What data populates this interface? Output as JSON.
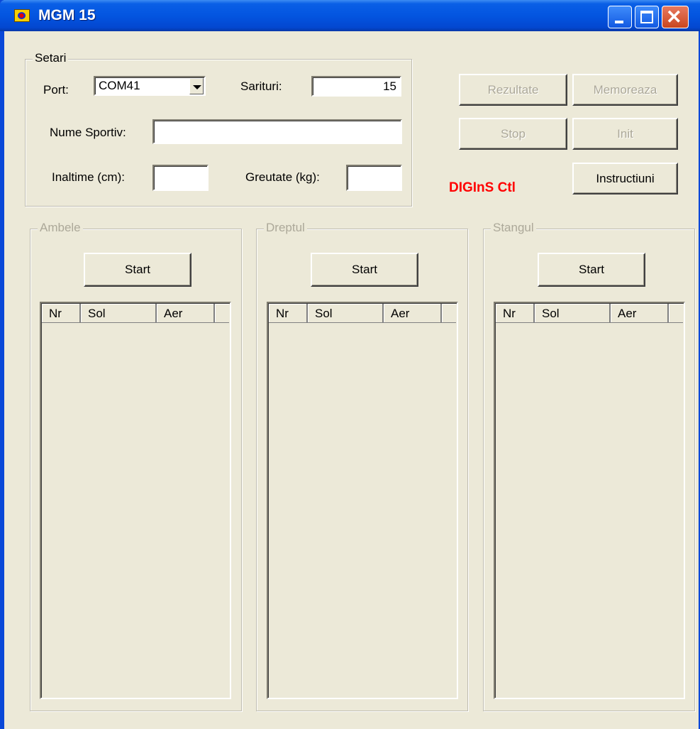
{
  "window": {
    "title": "MGM 15"
  },
  "settings": {
    "group_label": "Setari",
    "port_label": "Port:",
    "port_value": "COM41",
    "sarituri_label": "Sarituri:",
    "sarituri_value": "15",
    "nume_label": "Nume Sportiv:",
    "nume_value": "",
    "inaltime_label": "Inaltime (cm):",
    "inaltime_value": "",
    "greutate_label": "Greutate (kg):",
    "greutate_value": ""
  },
  "actions": {
    "rezultate": "Rezultate",
    "memoreaza": "Memoreaza",
    "stop": "Stop",
    "init": "Init",
    "instructiuni": "Instructiuni"
  },
  "brand": "DIGInS Ctl",
  "panels": [
    {
      "label": "Ambele",
      "start": "Start",
      "columns": [
        "Nr",
        "Sol",
        "Aer"
      ]
    },
    {
      "label": "Dreptul",
      "start": "Start",
      "columns": [
        "Nr",
        "Sol",
        "Aer"
      ]
    },
    {
      "label": "Stangul",
      "start": "Start",
      "columns": [
        "Nr",
        "Sol",
        "Aer"
      ]
    }
  ],
  "colors": {
    "title_bar": "#0355e0",
    "window_bg": "#ece9d8",
    "brand": "#ff0000"
  }
}
